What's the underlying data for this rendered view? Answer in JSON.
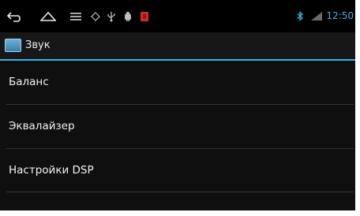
{
  "status_bar": {
    "time": "12:50",
    "icons": [
      "back-icon",
      "home-icon",
      "menu-icon",
      "gps-icon",
      "usb-icon",
      "android-debug-icon",
      "sd-card-icon",
      "bluetooth-icon",
      "signal-icon"
    ],
    "colors": {
      "accent": "#33b5e5",
      "warning": "#d02a2a"
    }
  },
  "action_bar": {
    "title": "Звук",
    "icon": "sound-settings-icon"
  },
  "list": {
    "items": [
      {
        "label": "Баланс"
      },
      {
        "label": "Эквалайзер"
      },
      {
        "label": "Настройки DSP"
      }
    ]
  }
}
